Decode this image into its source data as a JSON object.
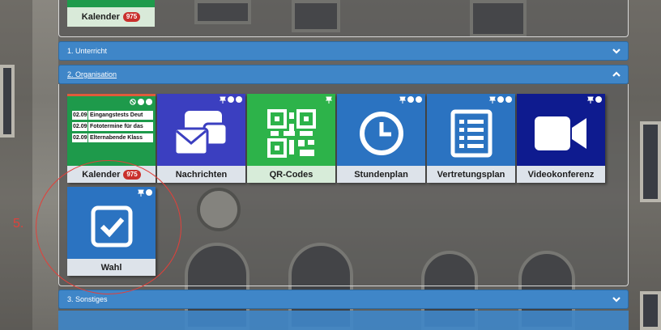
{
  "top_tile": {
    "label": "Kalender",
    "badge": "975"
  },
  "sections": [
    {
      "title": "1. Unterricht",
      "state": "collapsed"
    },
    {
      "title": "2. Organisation",
      "state": "expanded"
    },
    {
      "title": "3. Sonstiges",
      "state": "collapsed"
    }
  ],
  "tiles": [
    {
      "label": "Kalender",
      "badge": "975",
      "color": "#1e9a4b",
      "icon": "calendar-list-icon",
      "events": [
        {
          "date": "02.09",
          "text": "Eingangstests Deut"
        },
        {
          "date": "02.09",
          "text": "Fototermine für das"
        },
        {
          "date": "02.09",
          "text": "Elternabende Klass"
        }
      ]
    },
    {
      "label": "Nachrichten",
      "color": "#3b3fc0",
      "icon": "messages-icon"
    },
    {
      "label": "QR-Codes",
      "color": "#2db34a",
      "icon": "qr-code-icon"
    },
    {
      "label": "Stundenplan",
      "color": "#2b73c1",
      "icon": "clock-icon"
    },
    {
      "label": "Vertretungsplan",
      "color": "#2b73c1",
      "icon": "list-document-icon"
    },
    {
      "label": "Videokonferenz",
      "color": "#0e1b8f",
      "icon": "video-camera-icon"
    },
    {
      "label": "Wahl",
      "color": "#2b73c1",
      "icon": "checkbox-icon"
    }
  ],
  "annotation": {
    "label": "5.",
    "color": "#e2403a"
  }
}
